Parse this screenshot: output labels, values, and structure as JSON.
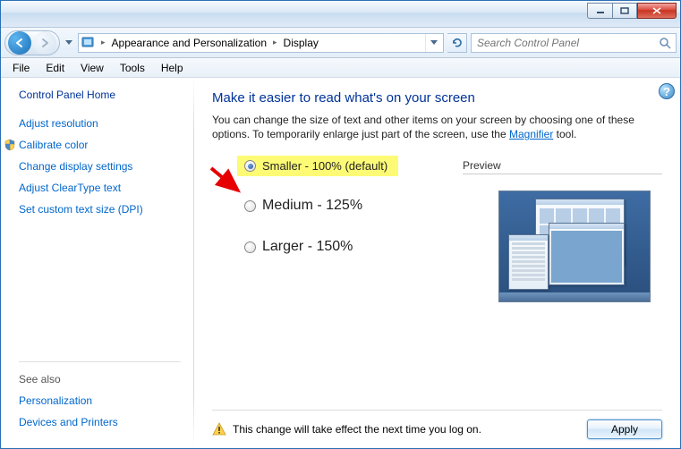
{
  "breadcrumb": {
    "seg1": "Appearance and Personalization",
    "seg2": "Display"
  },
  "search": {
    "placeholder": "Search Control Panel"
  },
  "menu": {
    "file": "File",
    "edit": "Edit",
    "view": "View",
    "tools": "Tools",
    "help": "Help"
  },
  "sidebar": {
    "home": "Control Panel Home",
    "links": {
      "adjust_resolution": "Adjust resolution",
      "calibrate_color": "Calibrate color",
      "change_display_settings": "Change display settings",
      "adjust_cleartype": "Adjust ClearType text",
      "custom_text_size": "Set custom text size (DPI)"
    },
    "see_also": "See also",
    "personalization": "Personalization",
    "devices_printers": "Devices and Printers"
  },
  "main": {
    "heading": "Make it easier to read what's on your screen",
    "subtext_pre": "You can change the size of text and other items on your screen by choosing one of these options. To temporarily enlarge just part of the screen, use the ",
    "subtext_link": "Magnifier",
    "subtext_post": " tool.",
    "options": {
      "smaller": "Smaller - 100% (default)",
      "medium": "Medium - 125%",
      "larger": "Larger - 150%"
    },
    "preview_label": "Preview",
    "notice": "This change will take effect the next time you log on.",
    "apply": "Apply"
  }
}
